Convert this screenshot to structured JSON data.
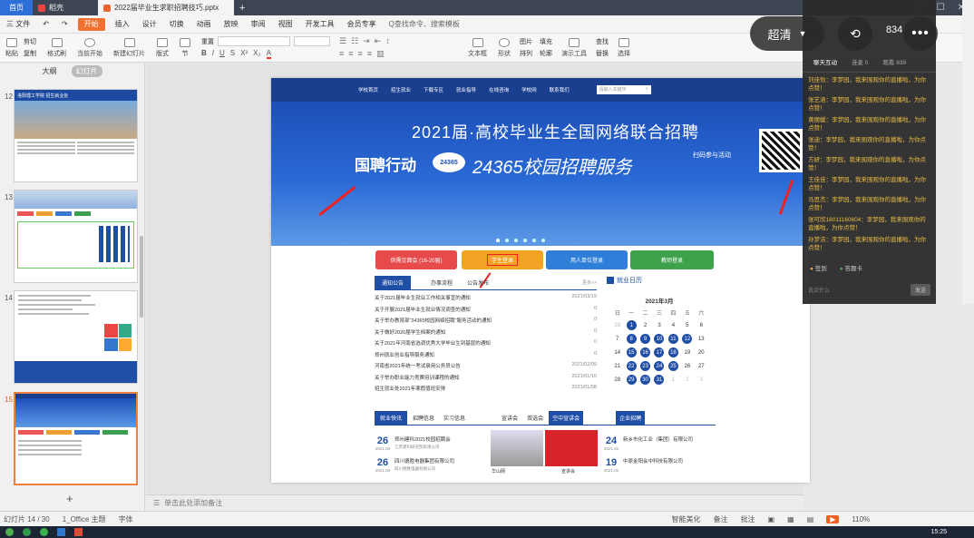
{
  "tabs": {
    "home": "首页",
    "tab1": "稻壳",
    "tab2": "2022届毕业生求职招聘技巧.pptx"
  },
  "menubar": {
    "file": "三 文件",
    "start": "开始",
    "insert": "插入",
    "design": "设计",
    "transition": "切换",
    "animation": "动画",
    "slideshow": "放映",
    "review": "审阅",
    "view": "视图",
    "devtools": "开发工具",
    "member": "会员专享",
    "search": "Q查找命令、搜索模板"
  },
  "ribbon": {
    "paste": "粘贴",
    "cut": "剪切",
    "copy": "复制",
    "format": "格式刷",
    "from_current": "当前开始",
    "new_slide": "新建幻灯片",
    "layout": "版式",
    "section": "节",
    "reset": "重置",
    "textbox": "文本框",
    "shape": "形状",
    "arrange": "排列",
    "outline": "轮廓",
    "present": "演示工具",
    "replace": "替换",
    "select": "选择",
    "picture": "图片",
    "fill": "填充",
    "find": "查找"
  },
  "leftpanel": {
    "tab_outline": "大纲",
    "tab_slides": "幻灯片",
    "nums": [
      "12",
      "13",
      "14",
      "15"
    ],
    "thumb12_title": "洛阳理工学院 招生就业处",
    "add": "+"
  },
  "slide": {
    "nav": [
      "学校首页",
      "招生就业",
      "下载专区",
      "就业指导",
      "在线咨询",
      "学校网",
      "联系我们"
    ],
    "search_placeholder": "请输入关键字",
    "banner_title": "2021届·高校毕业生全国网络联合招聘",
    "banner_brand": "国聘行动",
    "banner_badge": "24365",
    "banner_service": "24365校园招聘服务",
    "banner_scan": "扫码参与活动",
    "buttons": [
      "供需见面会 (16-20届)",
      "学生登录",
      "用人单位登录",
      "教师登录"
    ],
    "tabs": [
      "通知公告",
      "办事流程",
      "公告发布"
    ],
    "more": "更多>>",
    "news": [
      {
        "t": "关于2021届毕业生就业工作相关事宜的通知",
        "d": "2021/03/19"
      },
      {
        "t": "关于开展2021届毕业生就业情况调查的通知",
        "d": "0"
      },
      {
        "t": "关于举办教育部“24365校园网络招聘”服务活动的通知",
        "d": "0"
      },
      {
        "t": "关于做好2020届学生档案的通知",
        "d": "0"
      },
      {
        "t": "关于2021年河南省选调优秀大学毕业生到基层的通知",
        "d": "0"
      },
      {
        "t": "郑州就业创业指导服务通知",
        "d": "0"
      },
      {
        "t": "河南省2021年统一考试录用公务员公告",
        "d": "2021/02/09"
      },
      {
        "t": "关于举办职业能力竞赛培训课程的通知",
        "d": "2021/01/10"
      },
      {
        "t": "招生就业处2021年寒假值班安排",
        "d": "2021/01/08"
      }
    ],
    "cal_title": "就业日历",
    "cal_month": "2021年3月",
    "cal_week": [
      "日",
      "一",
      "二",
      "三",
      "四",
      "五",
      "六"
    ],
    "cal_days": [
      "28",
      "1",
      "2",
      "3",
      "4",
      "5",
      "6",
      "7",
      "8",
      "9",
      "10",
      "11",
      "12",
      "13",
      "14",
      "15",
      "16",
      "17",
      "18",
      "19",
      "20",
      "21",
      "22",
      "23",
      "24",
      "25",
      "26",
      "27",
      "28",
      "29",
      "30",
      "31",
      "1",
      "2",
      "3"
    ],
    "bottom_tabs": [
      "就业快讯",
      "招聘信息",
      "实习信息",
      "宣讲会",
      "双选会",
      "空中宣讲会",
      "企业招聘"
    ],
    "news2": [
      {
        "day": "26",
        "date": "2021.03",
        "t": "郑州建科2021校园招聘会",
        "s": "江苏建科研究院有限公司"
      },
      {
        "day": "26",
        "date": "2021.03",
        "t": "四川德胜电器集团有限公司",
        "s": "四川德胜电器有限公司"
      }
    ],
    "news3": [
      {
        "day": "24",
        "date": "2021.03",
        "t": "新乡市化工业（集团）有限公司"
      },
      {
        "day": "19",
        "date": "2021.03",
        "t": "中原金阳会中科技有限公司"
      }
    ],
    "img_caption1": "华山网",
    "img_caption2": "宣讲会"
  },
  "notes": "单击此处添加备注",
  "statusbar": {
    "slide": "幻灯片 14 / 30",
    "theme": "1_Office 主题",
    "font": "字体",
    "smart": "智能美化",
    "notes": "备注",
    "comments": "批注",
    "zoom": "110%"
  },
  "chat": {
    "tabs": [
      "聊天互动",
      "连麦 0",
      "观看 839"
    ],
    "messages": [
      "刘佳怡：李梦园，我来围观你的直播啦，为你点赞！",
      "张艺涵：李梦园，我来围观你的直播啦，为你点赞！",
      "黄丽媛：李梦园，我来围观你的直播啦，为你点赞！",
      "张迪：李梦园，我来围观你的直播啦，为你点赞！",
      "方妍：李梦园，我来围观你的直播啦，为你点赞！",
      "王佳佳：李梦园，我来围观你的直播啦，为你点赞！",
      "马思杰：李梦园，我来围观你的直播啦，为你点赞！",
      "张可欣18011160604：李梦园，我来围观你的直播啦，为你点赞！",
      "孙梦洁：李梦园，我来围观你的直播啦，为你点赞！"
    ],
    "sign": "签到",
    "answer": "答题卡",
    "input": "说点什么",
    "send": "发送"
  },
  "overlay": {
    "quality": "超清",
    "num1": "8",
    "num2": "34"
  },
  "clock": "15:25",
  "colors": {
    "accent": "#f07030",
    "navy": "#1a3f8f",
    "chat_text": "#e8b93a"
  }
}
